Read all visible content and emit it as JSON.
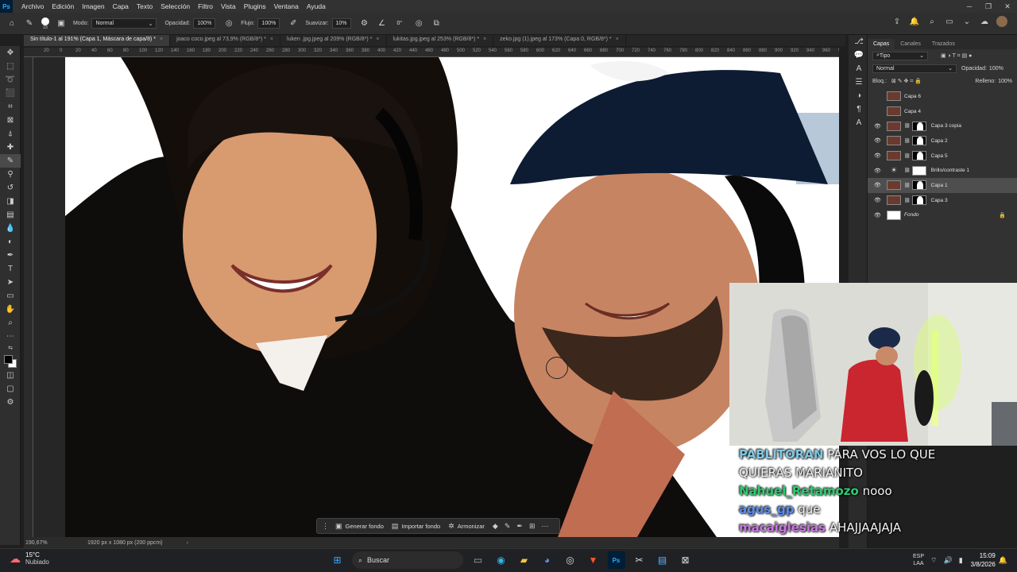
{
  "app": {
    "name": "Photoshop",
    "logo": "Ps"
  },
  "menu": [
    "Archivo",
    "Edición",
    "Imagen",
    "Capa",
    "Texto",
    "Selección",
    "Filtro",
    "Vista",
    "Plugins",
    "Ventana",
    "Ayuda"
  ],
  "options_bar": {
    "brush_size": "23",
    "mode_label": "Modo:",
    "mode_value": "Normal",
    "opacity_label": "Opacidad:",
    "opacity_value": "100%",
    "flow_label": "Flujo:",
    "flow_value": "100%",
    "smoothing_label": "Suavizar:",
    "smoothing_value": "10%",
    "angle_value": "0°"
  },
  "doc_tabs": [
    {
      "label": "Sin título-1 al 191% (Capa 1, Máscara de capa/8) *",
      "active": true
    },
    {
      "label": "joaco coco.jpeg al 73,9% (RGB/8*) *",
      "active": false
    },
    {
      "label": "luken .jpg.jpeg al 209% (RGB/8*) *",
      "active": false
    },
    {
      "label": "lukitas.jpg.jpeg al 253% (RGB/8*) *",
      "active": false
    },
    {
      "label": "zeko.jpg (1).jpeg al 173% (Capa 0, RGB/8*) *",
      "active": false
    }
  ],
  "ruler_ticks": [
    "20",
    "0",
    "20",
    "40",
    "60",
    "80",
    "100",
    "120",
    "140",
    "160",
    "180",
    "200",
    "220",
    "240",
    "260",
    "280",
    "300",
    "320",
    "340",
    "360",
    "380",
    "400",
    "420",
    "440",
    "460",
    "480",
    "500",
    "520",
    "540",
    "560",
    "580",
    "600",
    "620",
    "640",
    "660",
    "680",
    "700",
    "720",
    "740",
    "760",
    "780",
    "800",
    "820",
    "840",
    "860",
    "880",
    "900",
    "920",
    "940",
    "960",
    "980",
    "1000"
  ],
  "status": {
    "zoom": "190,67%",
    "doc_size": "1920 px x 1080 px (200 ppcm)"
  },
  "context_bar": {
    "generate_bg": "Generar fondo",
    "import_bg": "Importar fondo",
    "harmonize": "Armonizar"
  },
  "layers_panel": {
    "tabs": [
      "Capas",
      "Canales",
      "Trazados"
    ],
    "filter_label": "Tipo",
    "blend_mode": "Normal",
    "opacity_label": "Opacidad:",
    "opacity_value": "100%",
    "lock_label": "Bloq.:",
    "fill_label": "Relleno:",
    "fill_value": "100%",
    "layers": [
      {
        "name": "Capa 6",
        "visible": false,
        "mask": false,
        "selected": false
      },
      {
        "name": "Capa 4",
        "visible": false,
        "mask": false,
        "selected": false
      },
      {
        "name": "Capa 3 copia",
        "visible": true,
        "mask": true,
        "selected": false
      },
      {
        "name": "Capa 2",
        "visible": true,
        "mask": true,
        "selected": false
      },
      {
        "name": "Capa 5",
        "visible": true,
        "mask": true,
        "selected": false
      },
      {
        "name": "Brillo/contraste 1",
        "visible": true,
        "mask": false,
        "selected": false
      },
      {
        "name": "Capa 1",
        "visible": true,
        "mask": true,
        "selected": true
      },
      {
        "name": "Capa 3",
        "visible": true,
        "mask": true,
        "selected": false
      },
      {
        "name": "Fondo",
        "visible": true,
        "mask": false,
        "selected": false
      }
    ]
  },
  "chat": [
    {
      "user": "PABLITORAN",
      "message": "PARA VOS LO QUE",
      "color": "#7ec8e3"
    },
    {
      "user": "",
      "message": "QUIERAS MARIANITO",
      "color": "#ffffff"
    },
    {
      "user": "Nahuel_Retamozo",
      "message": "nooo",
      "color": "#2ecc71"
    },
    {
      "user": "agus_gp",
      "message": "que",
      "color": "#5b8def"
    },
    {
      "user": "macaiglesias",
      "message": "AHAJJAAJAJA",
      "color": "#c678dd"
    }
  ],
  "taskbar": {
    "weather_temp": "15°C",
    "weather_desc": "Nubiado",
    "search_placeholder": "Buscar",
    "lang_top": "ESP",
    "lang_bottom": "LAA",
    "time": "15:09",
    "date": "3/8/2026"
  }
}
